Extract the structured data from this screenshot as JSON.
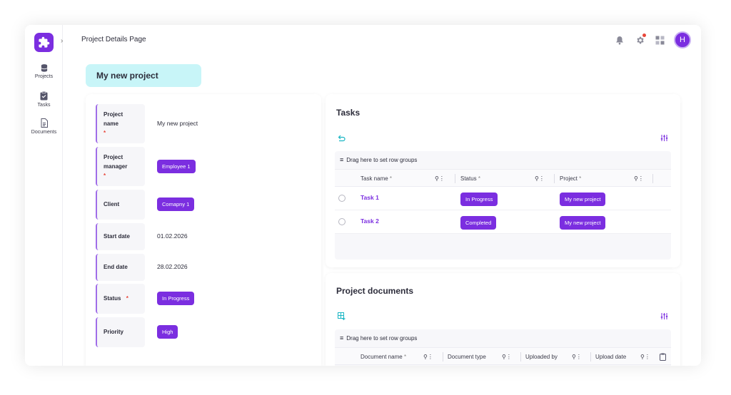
{
  "header": {
    "page_title": "Project Details Page",
    "avatar_initial": "H"
  },
  "sidebar": {
    "items": [
      {
        "label": "Projects",
        "icon": "database-icon"
      },
      {
        "label": "Tasks",
        "icon": "clipboard-icon"
      },
      {
        "label": "Documents",
        "icon": "document-icon"
      }
    ]
  },
  "project": {
    "title": "My new project",
    "fields": {
      "name_label_1": "Project",
      "name_label_2": "name",
      "name_value": "My new project",
      "manager_label_1": "Project",
      "manager_label_2": "manager",
      "manager_value": "Employee 1",
      "client_label": "Client",
      "client_value": "Comapny 1",
      "start_label": "Start date",
      "start_value": "01.02.2026",
      "end_label": "End date",
      "end_value": "28.02.2026",
      "status_label": "Status",
      "status_value": "In Progress",
      "priority_label": "Priority",
      "priority_value": "High",
      "required_mark": "*"
    }
  },
  "tasks": {
    "title": "Tasks",
    "group_hint": "Drag here to set row groups",
    "columns": [
      "Task name",
      "Status",
      "Project"
    ],
    "rows": [
      {
        "name": "Task 1",
        "status": "In Progress",
        "project": "My new project"
      },
      {
        "name": "Task 2",
        "status": "Completed",
        "project": "My new project"
      }
    ]
  },
  "documents": {
    "title": "Project documents",
    "group_hint": "Drag here to set row groups",
    "columns": [
      "Document name",
      "Document type",
      "Uploaded by",
      "Upload date"
    ]
  },
  "colors": {
    "accent": "#7b2ee0",
    "pill_bg": "#c8f5f8",
    "required": "#e8463a"
  }
}
